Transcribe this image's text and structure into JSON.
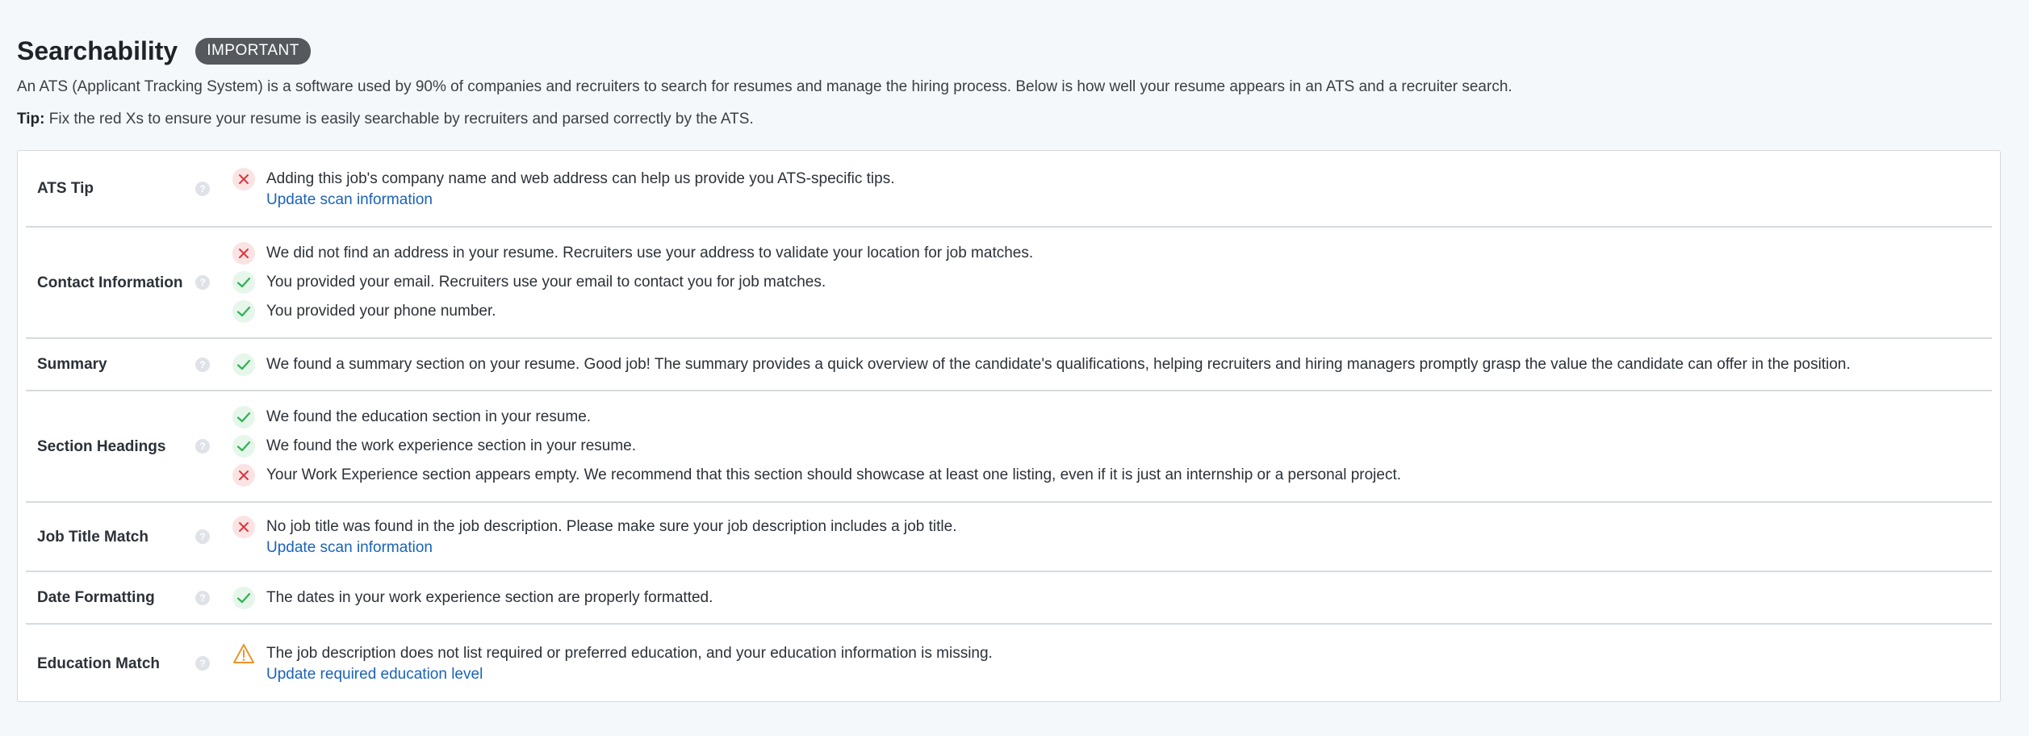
{
  "header": {
    "title": "Searchability",
    "badge": "IMPORTANT",
    "intro": "An ATS (Applicant Tracking System) is a software used by 90% of companies and recruiters to search for resumes and manage the hiring process. Below is how well your resume appears in an ATS and a recruiter search.",
    "tip_label": "Tip:",
    "tip_text": " Fix the red Xs to ensure your resume is easily searchable by recruiters and parsed correctly by the ATS."
  },
  "colors": {
    "fail": "#d9383f",
    "pass": "#2fb352",
    "warn": "#e8962b",
    "link": "#1a63b9"
  },
  "rows": [
    {
      "label": "ATS Tip",
      "items": [
        {
          "status": "fail",
          "text": "Adding this job's company name and web address can help us provide you ATS-specific tips.",
          "link": "Update scan information"
        }
      ]
    },
    {
      "label": "Contact Information",
      "items": [
        {
          "status": "fail",
          "text": "We did not find an address in your resume. Recruiters use your address to validate your location for job matches."
        },
        {
          "status": "pass",
          "text": "You provided your email. Recruiters use your email to contact you for job matches."
        },
        {
          "status": "pass",
          "text": "You provided your phone number."
        }
      ]
    },
    {
      "label": "Summary",
      "items": [
        {
          "status": "pass",
          "text": "We found a summary section on your resume. Good job! The summary provides a quick overview of the candidate's qualifications, helping recruiters and hiring managers promptly grasp the value the candidate can offer in the position."
        }
      ]
    },
    {
      "label": "Section Headings",
      "items": [
        {
          "status": "pass",
          "text": "We found the education section in your resume."
        },
        {
          "status": "pass",
          "text": "We found the work experience section in your resume."
        },
        {
          "status": "fail",
          "text": "Your Work Experience section appears empty. We recommend that this section should showcase at least one listing, even if it is just an internship or a personal project."
        }
      ]
    },
    {
      "label": "Job Title Match",
      "items": [
        {
          "status": "fail",
          "text": "No job title was found in the job description. Please make sure your job description includes a job title.",
          "link": "Update scan information"
        }
      ]
    },
    {
      "label": "Date Formatting",
      "items": [
        {
          "status": "pass",
          "text": "The dates in your work experience section are properly formatted."
        }
      ]
    },
    {
      "label": "Education Match",
      "items": [
        {
          "status": "warn",
          "text": "The job description does not list required or preferred education, and your education information is missing.",
          "link": "Update required education level"
        }
      ]
    }
  ]
}
